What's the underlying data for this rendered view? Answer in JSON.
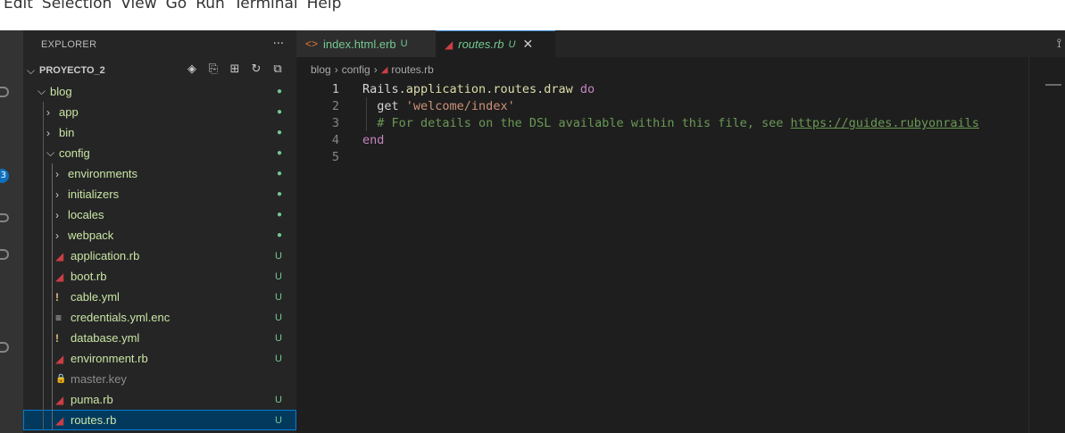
{
  "menubar": [
    "Edit",
    "Selection",
    "View",
    "Go",
    "Run",
    "Terminal",
    "Help"
  ],
  "activity_bar": {
    "badge": "3"
  },
  "explorer": {
    "title": "EXPLORER",
    "more": "···",
    "project": "PROYECTO_2",
    "actions": [
      "eye-icon",
      "new-file-icon",
      "new-folder-icon",
      "refresh-icon",
      "collapse-all-icon"
    ],
    "tree": [
      {
        "label": "blog",
        "kind": "folder",
        "expanded": true,
        "depth": 1,
        "status": "●"
      },
      {
        "label": "app",
        "kind": "folder",
        "expanded": false,
        "depth": 2,
        "status": "●"
      },
      {
        "label": "bin",
        "kind": "folder",
        "expanded": false,
        "depth": 2,
        "status": "●"
      },
      {
        "label": "config",
        "kind": "folder",
        "expanded": true,
        "depth": 2,
        "status": "●"
      },
      {
        "label": "environments",
        "kind": "folder",
        "expanded": false,
        "depth": 3,
        "status": "●"
      },
      {
        "label": "initializers",
        "kind": "folder",
        "expanded": false,
        "depth": 3,
        "status": "●"
      },
      {
        "label": "locales",
        "kind": "folder",
        "expanded": false,
        "depth": 3,
        "status": "●"
      },
      {
        "label": "webpack",
        "kind": "folder",
        "expanded": false,
        "depth": 3,
        "status": "●"
      },
      {
        "label": "application.rb",
        "kind": "ruby",
        "depth": 3,
        "status": "U"
      },
      {
        "label": "boot.rb",
        "kind": "ruby",
        "depth": 3,
        "status": "U"
      },
      {
        "label": "cable.yml",
        "kind": "yml",
        "depth": 3,
        "status": "U"
      },
      {
        "label": "credentials.yml.enc",
        "kind": "enc",
        "depth": 3,
        "status": "U"
      },
      {
        "label": "database.yml",
        "kind": "yml",
        "depth": 3,
        "status": "U"
      },
      {
        "label": "environment.rb",
        "kind": "ruby",
        "depth": 3,
        "status": "U"
      },
      {
        "label": "master.key",
        "kind": "key",
        "depth": 3,
        "status": ""
      },
      {
        "label": "puma.rb",
        "kind": "ruby",
        "depth": 3,
        "status": "U"
      },
      {
        "label": "routes.rb",
        "kind": "ruby",
        "depth": 3,
        "status": "U",
        "selected": true
      }
    ]
  },
  "tabs": [
    {
      "label": "index.html.erb",
      "marker": "U",
      "active": false,
      "icon": "html-icon"
    },
    {
      "label": "routes.rb",
      "marker": "U",
      "active": true,
      "icon": "ruby-icon",
      "close": "✕"
    }
  ],
  "breadcrumb": [
    "blog",
    "config",
    "routes.rb"
  ],
  "editor": {
    "lines": [
      {
        "n": "1",
        "tokens": [
          [
            "c-plain",
            "Rails."
          ],
          [
            "c-fn",
            "application"
          ],
          [
            "c-plain",
            "."
          ],
          [
            "c-fn",
            "routes"
          ],
          [
            "c-plain",
            "."
          ],
          [
            "c-fn",
            "draw"
          ],
          [
            "c-plain",
            " "
          ],
          [
            "c-kw",
            "do"
          ]
        ]
      },
      {
        "n": "2",
        "tokens": [
          [
            "c-plain",
            "  get "
          ],
          [
            "c-str",
            "'welcome/index'"
          ]
        ]
      },
      {
        "n": "3",
        "tokens": [
          [
            "c-cm",
            "  # For details on the DSL available within this file, see "
          ],
          [
            "c-link",
            "https://guides.rubyonrails"
          ]
        ]
      },
      {
        "n": "4",
        "tokens": [
          [
            "c-kw",
            "end"
          ]
        ]
      },
      {
        "n": "5",
        "tokens": []
      }
    ]
  }
}
